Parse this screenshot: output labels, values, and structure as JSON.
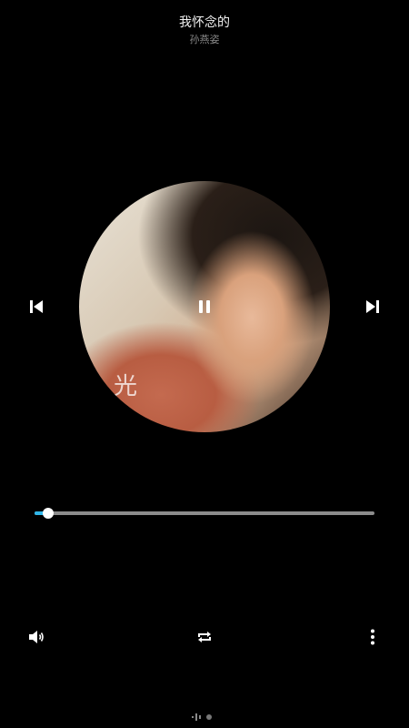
{
  "song": {
    "title": "我怀念的",
    "artist": "孙燕姿"
  },
  "cover": {
    "overlay_char": "光"
  },
  "controls": {
    "prev_icon": "skip-previous-icon",
    "play_pause_icon": "pause-icon",
    "next_icon": "skip-next-icon",
    "state": "playing"
  },
  "seek": {
    "progress": 0.04,
    "fill_color": "#2fb5e8"
  },
  "bottom_bar": {
    "volume_icon": "volume-icon",
    "repeat_icon": "repeat-icon",
    "more_icon": "more-vertical-icon"
  },
  "pager": {
    "pages": 2,
    "current": 1
  }
}
